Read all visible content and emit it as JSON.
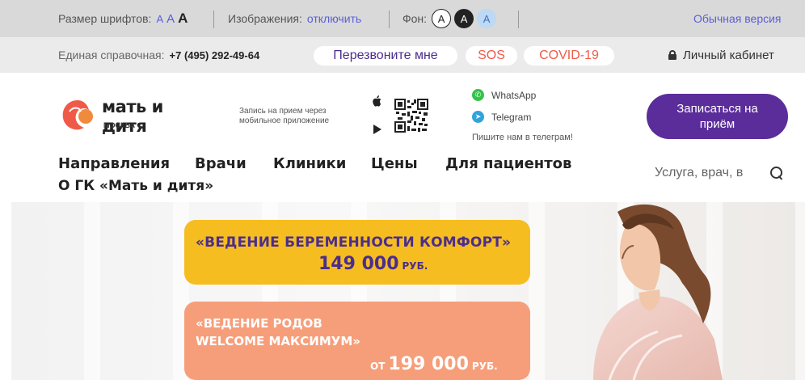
{
  "a11y": {
    "font_size_label": "Размер шрифтов:",
    "font_sizes": [
      "A",
      "A",
      "A"
    ],
    "images_label": "Изображения:",
    "images_action": "отключить",
    "background_label": "Фон:",
    "background_options": [
      "A",
      "A",
      "A"
    ],
    "normal_version": "Обычная версия"
  },
  "contact": {
    "phone_label": "Единая справочная:",
    "phone": "+7 (495) 292-49-64",
    "callback": "Перезвоните мне",
    "sos": "SOS",
    "covid": "COVID-19",
    "account": "Личный кабинет"
  },
  "header": {
    "logo_text": "мать и дитя",
    "city": "МОСКВА",
    "app_caption": "Запись на прием через мобильное приложение",
    "whatsapp": "WhatsApp",
    "telegram": "Telegram",
    "telegram_caption": "Пишите нам в телеграм!",
    "book_button": "Записаться на приём",
    "nav": [
      "Направления",
      "Врачи",
      "Клиники",
      "Цены",
      "Для пациентов",
      "О ГК «Мать и дитя»"
    ],
    "search_placeholder": "Услуга, врач, в"
  },
  "hero": {
    "promo1_title": "«ВЕДЕНИЕ БЕРЕМЕННОСТИ КОМФОРТ»",
    "promo1_price": "149 000",
    "promo1_currency": "РУБ.",
    "promo2_line1": "«ВЕДЕНИЕ РОДОВ",
    "promo2_line2": "WELCOME МАКСИМУМ»",
    "promo2_from": "ОТ",
    "promo2_price": "199 000",
    "promo2_currency": "РУБ."
  },
  "colors": {
    "brand_purple": "#5b2d9b",
    "accent_red": "#ef5a48",
    "promo_yellow": "#f5bd1f",
    "promo_salmon": "#f69e7a"
  }
}
